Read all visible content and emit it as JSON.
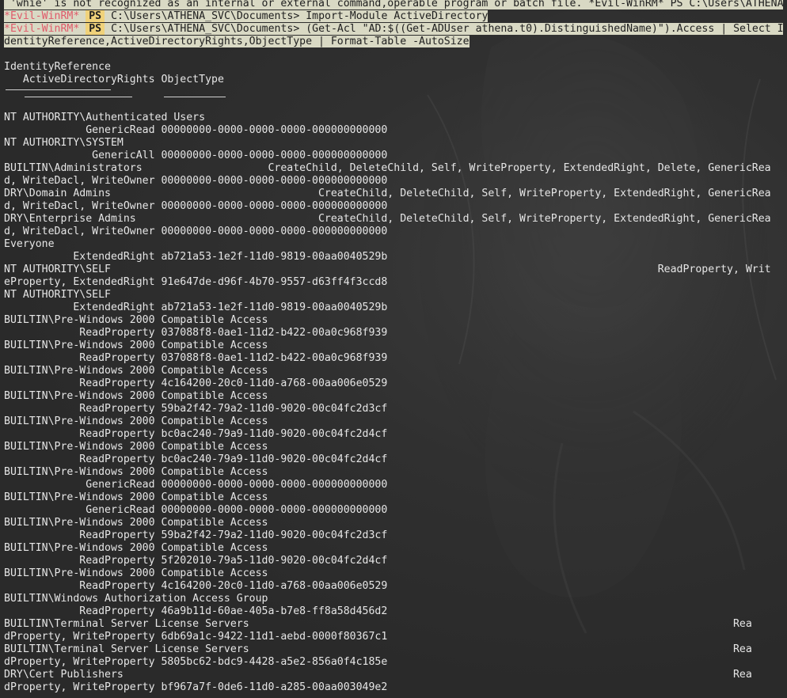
{
  "colors": {
    "background": "#2a2a2a",
    "text": "#e6e6e6",
    "selection": "#d9d9c4",
    "prompt_prefix": "#e05a6a",
    "ps_badge": "#f0d27a"
  },
  "prompt": {
    "prefix": "*Evil-WinRM*",
    "badge": "PS"
  },
  "top_partial_line": " 'whie' is not recognized as an internal or external command,operable program or batch file. *Evil-WinRM* PS C:\\Users\\ATHENA_",
  "commands": [
    {
      "path": "C:\\Users\\ATHENA_SVC\\Documents>",
      "text": " Import-Module ActiveDirectory"
    },
    {
      "path": "C:\\Users\\ATHENA_SVC\\Documents>",
      "text": " (Get-Acl \"AD:$((Get-ADUser athena.t0).DistinguishedName)\").Access | Select I"
    }
  ],
  "command_wrap": "dentityReference,ActiveDirectoryRights,ObjectType | Format-Table -AutoSize",
  "table_header": {
    "line1": "IdentityReference",
    "line2": "   ActiveDirectoryRights ObjectType"
  },
  "output_lines": [
    "NT AUTHORITY\\Authenticated Users",
    "             GenericRead 00000000-0000-0000-0000-000000000000",
    "NT AUTHORITY\\SYSTEM",
    "              GenericAll 00000000-0000-0000-0000-000000000000",
    "BUILTIN\\Administrators                    CreateChild, DeleteChild, Self, WriteProperty, ExtendedRight, Delete, GenericRea",
    "d, WriteDacl, WriteOwner 00000000-0000-0000-0000-000000000000",
    "DRY\\Domain Admins                                 CreateChild, DeleteChild, Self, WriteProperty, ExtendedRight, GenericRea",
    "d, WriteDacl, WriteOwner 00000000-0000-0000-0000-000000000000",
    "DRY\\Enterprise Admins                             CreateChild, DeleteChild, Self, WriteProperty, ExtendedRight, GenericRea",
    "d, WriteDacl, WriteOwner 00000000-0000-0000-0000-000000000000",
    "Everyone",
    "           ExtendedRight ab721a53-1e2f-11d0-9819-00aa0040529b",
    "NT AUTHORITY\\SELF                                                                                       ReadProperty, Writ",
    "eProperty, ExtendedRight 91e647de-d96f-4b70-9557-d63ff4f3ccd8",
    "NT AUTHORITY\\SELF",
    "           ExtendedRight ab721a53-1e2f-11d0-9819-00aa0040529b",
    "BUILTIN\\Pre-Windows 2000 Compatible Access",
    "            ReadProperty 037088f8-0ae1-11d2-b422-00a0c968f939",
    "BUILTIN\\Pre-Windows 2000 Compatible Access",
    "            ReadProperty 037088f8-0ae1-11d2-b422-00a0c968f939",
    "BUILTIN\\Pre-Windows 2000 Compatible Access",
    "            ReadProperty 4c164200-20c0-11d0-a768-00aa006e0529",
    "BUILTIN\\Pre-Windows 2000 Compatible Access",
    "            ReadProperty 59ba2f42-79a2-11d0-9020-00c04fc2d3cf",
    "BUILTIN\\Pre-Windows 2000 Compatible Access",
    "            ReadProperty bc0ac240-79a9-11d0-9020-00c04fc2d4cf",
    "BUILTIN\\Pre-Windows 2000 Compatible Access",
    "            ReadProperty bc0ac240-79a9-11d0-9020-00c04fc2d4cf",
    "BUILTIN\\Pre-Windows 2000 Compatible Access",
    "             GenericRead 00000000-0000-0000-0000-000000000000",
    "BUILTIN\\Pre-Windows 2000 Compatible Access",
    "             GenericRead 00000000-0000-0000-0000-000000000000",
    "BUILTIN\\Pre-Windows 2000 Compatible Access",
    "            ReadProperty 59ba2f42-79a2-11d0-9020-00c04fc2d3cf",
    "BUILTIN\\Pre-Windows 2000 Compatible Access",
    "            ReadProperty 5f202010-79a5-11d0-9020-00c04fc2d4cf",
    "BUILTIN\\Pre-Windows 2000 Compatible Access",
    "            ReadProperty 4c164200-20c0-11d0-a768-00aa006e0529",
    "BUILTIN\\Windows Authorization Access Group",
    "            ReadProperty 46a9b11d-60ae-405a-b7e8-ff8a58d456d2",
    "BUILTIN\\Terminal Server License Servers                                                                             Rea",
    "dProperty, WriteProperty 6db69a1c-9422-11d1-aebd-0000f80367c1",
    "BUILTIN\\Terminal Server License Servers                                                                             Rea",
    "dProperty, WriteProperty 5805bc62-bdc9-4428-a5e2-856a0f4c185e",
    "DRY\\Cert Publishers                                                                                                 Rea",
    "dProperty, WriteProperty bf967a7f-0de6-11d0-a285-00aa003049e2"
  ]
}
